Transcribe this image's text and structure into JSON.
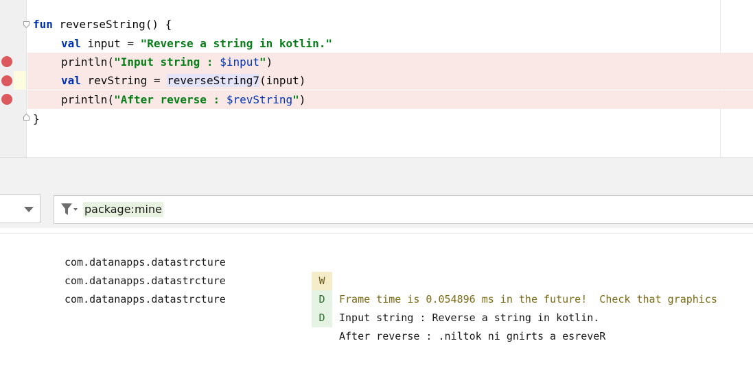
{
  "editor": {
    "lines": [
      {
        "kw1": "fun",
        "rest": " reverseString() {"
      },
      {
        "kw1": "val",
        "mid": " input = ",
        "str": "\"Reverse a string in kotlin.\""
      },
      {
        "pre": "println(",
        "str": "\"Input string : ",
        "tpl": "$input",
        "str2": "\"",
        "post": ")"
      },
      {
        "kw1": "val",
        "mid": " revString = ",
        "hl": "reverseString7",
        "post": "(input)"
      },
      {
        "pre": "println(",
        "str": "\"After reverse : ",
        "tpl": "$revString",
        "str2": "\"",
        "post": ")"
      },
      {
        "rest": "}"
      }
    ]
  },
  "logcat": {
    "filter": {
      "value": "package:mine"
    },
    "rows": [
      {
        "package": "com.datanapps.datastrcture",
        "level": "W",
        "message": "Frame time is 0.054896 ms in the future!  Check that graphics"
      },
      {
        "package": "com.datanapps.datastrcture",
        "level": "D",
        "message": "Input string : Reverse a string in kotlin."
      },
      {
        "package": "com.datanapps.datastrcture",
        "level": "D",
        "message": "After reverse : .niltok ni gnirts a esreveR"
      }
    ]
  },
  "colors": {
    "keyword": "#0033b3",
    "string": "#067d17",
    "breakpoint": "#dc5a5e",
    "breakpoint_line": "#f9e8e5"
  }
}
